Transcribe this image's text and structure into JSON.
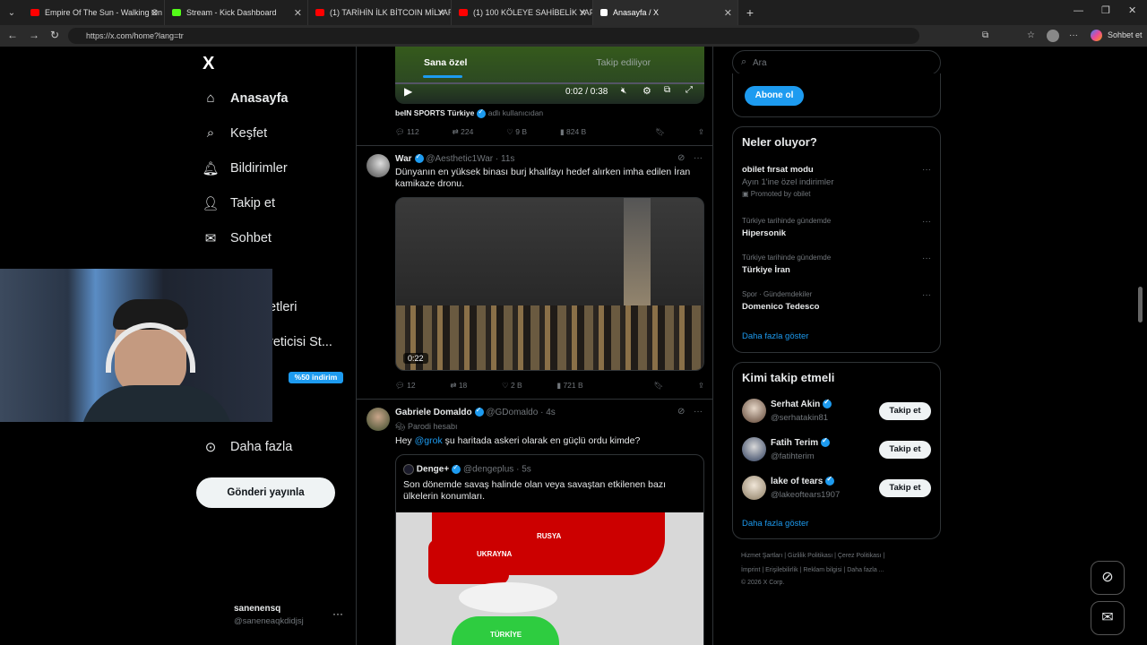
{
  "browser": {
    "tabs": [
      {
        "label": "Empire Of The Sun - Walking On A",
        "color": "#ff0000"
      },
      {
        "label": "Stream - Kick Dashboard",
        "color": "#53fc18"
      },
      {
        "label": "(1) TARİHİN İLK BİTCOIN MİLYARDE",
        "color": "#ff0000"
      },
      {
        "label": "(1) 100 KÖLEYE SAHİBELİK YAPTIM",
        "color": "#ff0000"
      },
      {
        "label": "Anasayfa / X",
        "color": "#ffffff"
      }
    ],
    "url": "https://x.com/home?lang=tr",
    "chat_label": "Sohbet et"
  },
  "sidebar": {
    "logo": "X",
    "items": [
      {
        "label": "Anasayfa",
        "icon": "home-icon"
      },
      {
        "label": "Keşfet",
        "icon": "search-icon"
      },
      {
        "label": "Bildirimler",
        "icon": "bell-icon"
      },
      {
        "label": "Takip et",
        "icon": "follow-icon"
      },
      {
        "label": "Sohbet",
        "icon": "mail-icon"
      },
      {
        "label": "etleri",
        "icon": ""
      },
      {
        "label": "reticisi St...",
        "icon": ""
      },
      {
        "label": "Daha fazla",
        "icon": "more-icon"
      }
    ],
    "discount_badge": "%50 indirim",
    "post_button": "Gönderi yayınla",
    "account": {
      "name": "sanenensq",
      "handle": "@saneneaqkdidjsj"
    }
  },
  "timeline": {
    "tabs": [
      "Sana özel",
      "Takip ediliyor"
    ],
    "video_time": "0:02 / 0:38",
    "tweet0": {
      "source_name": "beIN SPORTS Türkiye",
      "source_suffix": "adlı kullanıcıdan",
      "replies": "112",
      "retweets": "224",
      "likes": "9 B",
      "views": "824 B"
    },
    "tweet1": {
      "name": "War",
      "handle": "@Aesthetic1War",
      "time": "11s",
      "text": "Dünyanın en yüksek binası burj khalifayı hedef alırken imha edilen İran kamikaze dronu.",
      "video_duration": "0:22",
      "replies": "12",
      "retweets": "18",
      "likes": "2 B",
      "views": "721 B"
    },
    "tweet2": {
      "name": "Gabriele Domaldo",
      "handle": "@GDomaldo",
      "time": "4s",
      "parody": "Parodi hesabı",
      "text_mention": "@grok",
      "text_prefix": "Hey",
      "text_rest": "şu haritada askeri olarak en güçlü ordu kimde?",
      "quote": {
        "name": "Denge+",
        "handle": "@dengeplus",
        "time": "5s",
        "text": "Son dönemde savaş halinde olan veya savaştan etkilenen bazı ülkelerin konumları."
      },
      "map_labels": [
        "RUSYA",
        "UKRAYNA",
        "TÜRKİYE"
      ]
    }
  },
  "right": {
    "search_placeholder": "Ara",
    "subscribe": "Abone ol",
    "trends_title": "Neler oluyor?",
    "trends": [
      {
        "title": "obilet fırsat modu",
        "sub": "Ayın 1'ine özel indirimler",
        "meta": "Promoted by obilet"
      },
      {
        "meta": "Türkiye tarihinde gündemde",
        "title": "Hipersonik"
      },
      {
        "meta": "Türkiye tarihinde gündemde",
        "title": "Türkiye İran"
      },
      {
        "meta": "Spor · Gündemdekiler",
        "title": "Domenico Tedesco"
      }
    ],
    "show_more": "Daha fazla göster",
    "who_title": "Kimi takip etmeli",
    "who": [
      {
        "name": "Serhat Akin",
        "handle": "@serhatakin81"
      },
      {
        "name": "Fatih Terim",
        "handle": "@fatihterim"
      },
      {
        "name": "lake of tears",
        "handle": "@lakeoftears1907"
      }
    ],
    "follow_label": "Takip et",
    "footer_line1": "Hizmet Şartları  |  Gizlilik Politikası  |  Çerez Politikası  |",
    "footer_line2": "İmprint  |  Erişilebilirlik  |  Reklam bilgisi  |  Daha fazla ...",
    "footer_line3": "© 2026 X Corp."
  }
}
